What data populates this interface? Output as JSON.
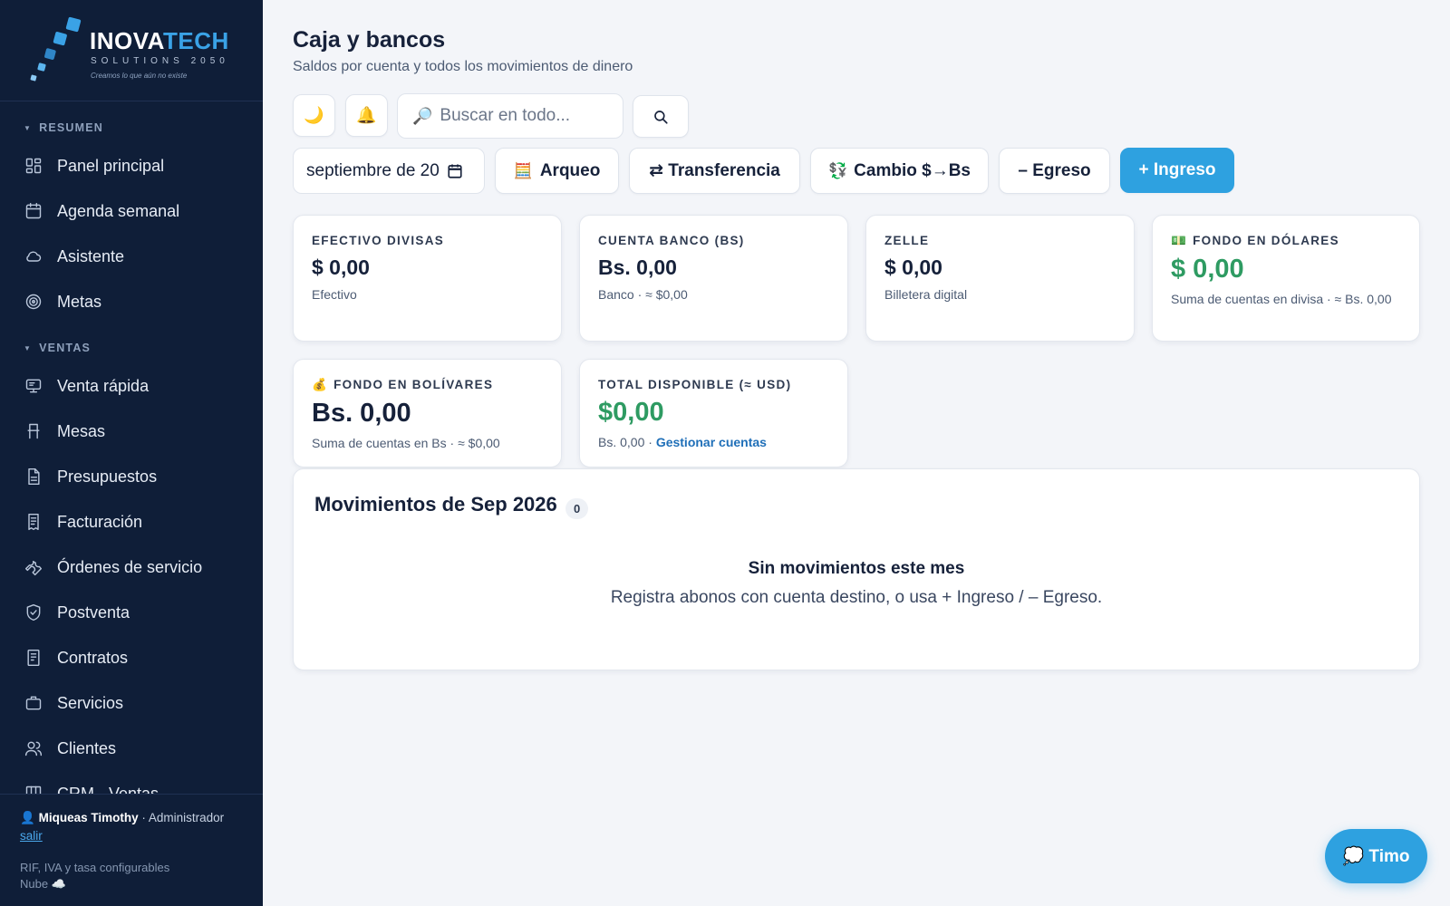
{
  "brand": {
    "title_white": "INOVA",
    "title_blue": "TECH",
    "subtitle": "SOLUTIONS 2050",
    "tagline": "Creamos lo que aún no existe"
  },
  "sidebar": {
    "sections": [
      {
        "label": "RESUMEN"
      },
      {
        "label": "VENTAS"
      }
    ],
    "items": [
      {
        "label": "Panel principal",
        "icon": "dashboard-icon"
      },
      {
        "label": "Agenda semanal",
        "icon": "calendar-icon"
      },
      {
        "label": "Asistente",
        "icon": "cloud-icon"
      },
      {
        "label": "Metas",
        "icon": "target-icon"
      },
      {
        "label": "Venta rápida",
        "icon": "pos-terminal-icon"
      },
      {
        "label": "Mesas",
        "icon": "chair-icon"
      },
      {
        "label": "Presupuestos",
        "icon": "document-icon"
      },
      {
        "label": "Facturación",
        "icon": "receipt-icon"
      },
      {
        "label": "Órdenes de servicio",
        "icon": "wrench-icon"
      },
      {
        "label": "Postventa",
        "icon": "shield-check-icon"
      },
      {
        "label": "Contratos",
        "icon": "contract-icon"
      },
      {
        "label": "Servicios",
        "icon": "briefcase-icon"
      },
      {
        "label": "Clientes",
        "icon": "users-icon"
      },
      {
        "label": "CRM · Ventas",
        "icon": "kanban-icon"
      }
    ],
    "footer": {
      "user_icon": "👤",
      "user_name": "Miqueas Timothy",
      "role": "· Administrador",
      "logout": "salir",
      "config": "RIF, IVA y tasa configurables",
      "cloud": "Nube ☁️"
    }
  },
  "header": {
    "title": "Caja y bancos",
    "subtitle": "Saldos por cuenta y todos los movimientos de dinero"
  },
  "toolbar": {
    "theme_icon": "🌙",
    "bell_icon": "🔔",
    "search_icon": "🔎",
    "search_placeholder": "Buscar en todo...",
    "date_value": "septiembre de 20",
    "arqueo_icon": "🧮",
    "arqueo_label": "Arqueo",
    "transfer_label": "⇄ Transferencia",
    "exchange_icon": "💱",
    "exchange_label": "Cambio $→Bs",
    "egreso_label": "– Egreso",
    "ingreso_label": "+ Ingreso"
  },
  "cards": {
    "efectivo": {
      "label": "EFECTIVO DIVISAS",
      "value": "$ 0,00",
      "note": "Efectivo"
    },
    "banco": {
      "label": "CUENTA BANCO (BS)",
      "value": "Bs. 0,00",
      "note": "Banco · ≈ $0,00"
    },
    "zelle": {
      "label": "ZELLE",
      "value": "$ 0,00",
      "note": "Billetera digital"
    },
    "fondo_usd": {
      "icon": "💵",
      "label": "FONDO EN DÓLARES",
      "value": "$ 0,00",
      "note": "Suma de cuentas en divisa · ≈ Bs. 0,00"
    },
    "fondo_bs": {
      "icon": "💰",
      "label": "FONDO EN BOLÍVARES",
      "value": "Bs. 0,00",
      "note": "Suma de cuentas en Bs · ≈ $0,00"
    },
    "total": {
      "label": "TOTAL DISPONIBLE (≈ USD)",
      "value": "$0,00",
      "note": "Bs. 0,00 · ",
      "link": "Gestionar cuentas"
    }
  },
  "movements": {
    "title": "Movimientos de Sep 2026",
    "count": "0",
    "empty_title": "Sin movimientos este mes",
    "empty_text": "Registra abonos con cuenta destino, o usa + Ingreso / – Egreso."
  },
  "chat": {
    "label": "💭 Timo"
  },
  "colors": {
    "sidebar_bg": "#0f1e38",
    "accent": "#2ea1e0",
    "positive": "#2e9b62",
    "page_bg": "#f3f5f9"
  }
}
